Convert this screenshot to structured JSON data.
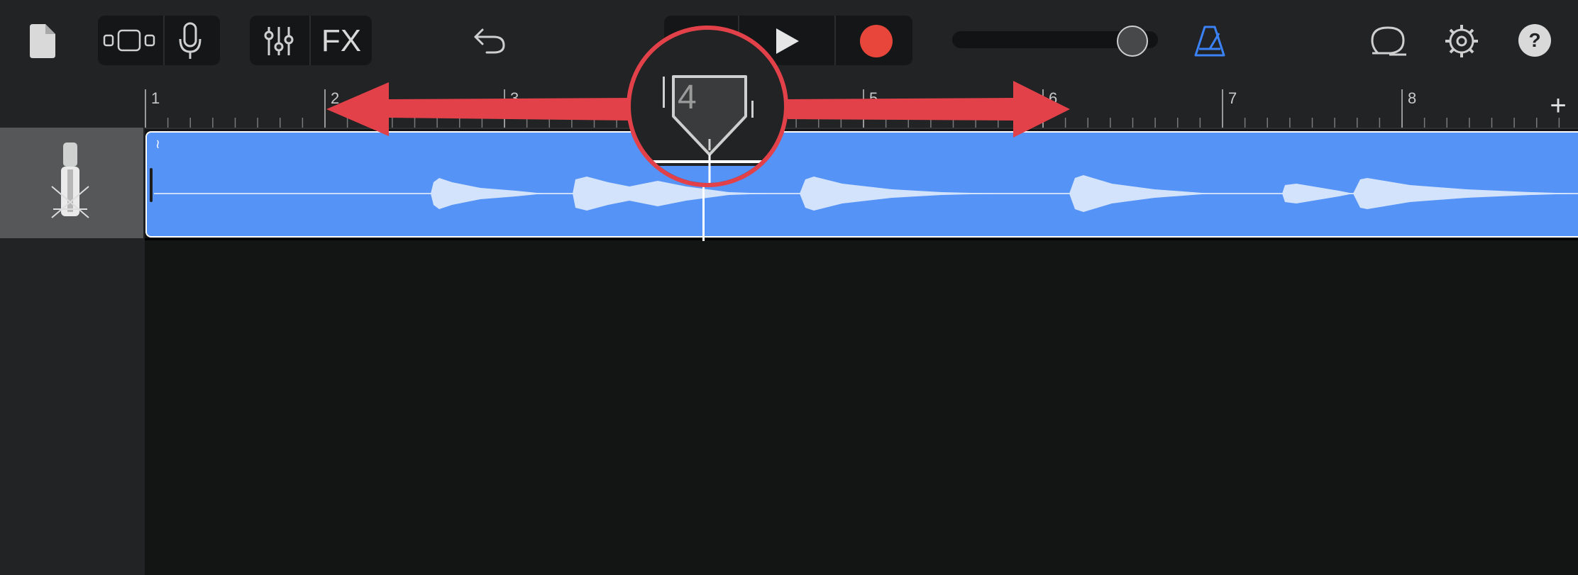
{
  "toolbar": {
    "fx_label": "FX",
    "record_color": "#e8463b",
    "metronome_color": "#3b82f6",
    "help_label": "?"
  },
  "ruler": {
    "bars": [
      "1",
      "2",
      "3",
      "5",
      "6",
      "7",
      "8"
    ],
    "add_label": "+",
    "playhead_bar": "4"
  },
  "track": {
    "region_color": "#5593f7",
    "instrument_icon": "microphone-icon"
  },
  "annotation": {
    "color": "#e34149"
  }
}
